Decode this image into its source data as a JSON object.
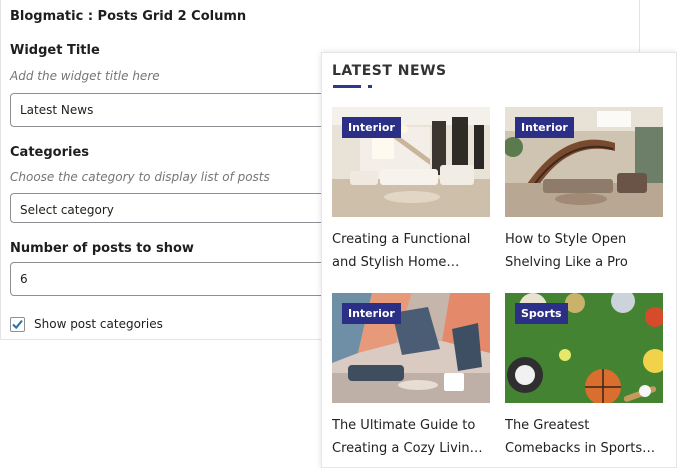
{
  "form": {
    "panel_title": "Blogmatic : Posts Grid 2 Column",
    "widget_title": {
      "label": "Widget Title",
      "help": "Add the widget title here",
      "value": "Latest News"
    },
    "categories": {
      "label": "Categories",
      "help": "Choose the category to display list of posts",
      "value": "Select category"
    },
    "posts_count": {
      "label": "Number of posts to show",
      "value": "6"
    },
    "show_categories": {
      "label": "Show post categories",
      "checked": true
    }
  },
  "preview": {
    "title": "LATEST NEWS",
    "accent": "#2b3a8c",
    "posts": [
      {
        "category": "Interior",
        "title": "Creating a Functional and Stylish Home…",
        "image": "interior-living-room"
      },
      {
        "category": "Interior",
        "title": "How to Style Open Shelving Like a Pro",
        "image": "interior-staircase"
      },
      {
        "category": "Interior",
        "title": "The Ultimate Guide to Creating a Cozy Livin…",
        "image": "interior-abstract-room"
      },
      {
        "category": "Sports",
        "title": "The Greatest Comebacks in Sports…",
        "image": "sports-balls-on-grass"
      }
    ]
  }
}
